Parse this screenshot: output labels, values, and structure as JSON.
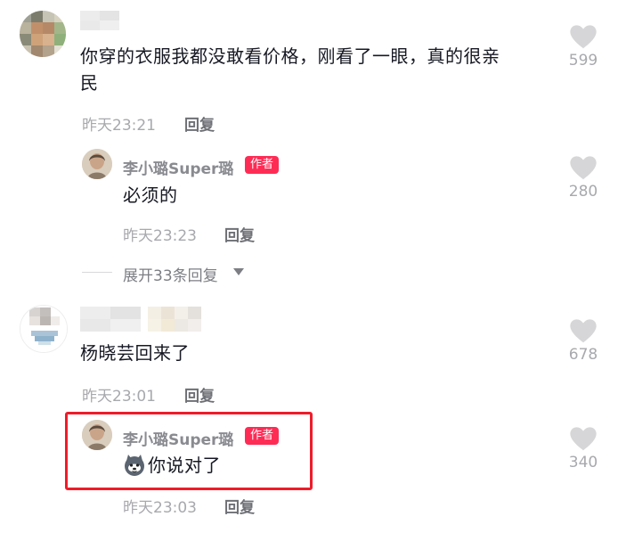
{
  "comments": [
    {
      "text_line1": "你穿的衣服我都没敢看价格，刚看了一眼，真的很亲",
      "text_line2": "民",
      "time": "昨天23:21",
      "reply_label": "回复",
      "likes": "599",
      "reply": {
        "author": "李小璐Super璐",
        "badge": "作者",
        "text": "必须的",
        "time": "昨天23:23",
        "reply_label": "回复",
        "likes": "280"
      },
      "expand_label": "展开33条回复"
    },
    {
      "text_line1": "杨晓芸回来了",
      "time": "昨天23:01",
      "reply_label": "回复",
      "likes": "678",
      "reply": {
        "author": "李小璐Super璐",
        "badge": "作者",
        "emoji_icon": "husky-emoji-icon",
        "text": "你说对了",
        "time": "昨天23:03",
        "reply_label": "回复",
        "likes": "340"
      }
    }
  ],
  "colors": {
    "accent": "#fe2c55",
    "highlight": "#f01c2a",
    "meta_gray": "#a8a9ad",
    "reply_gray": "#6e7076"
  }
}
